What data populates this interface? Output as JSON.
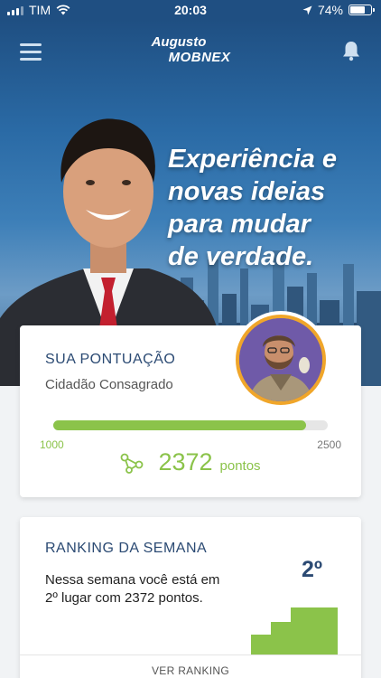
{
  "status_bar": {
    "carrier": "TIM",
    "time": "20:03",
    "battery_percent": "74%",
    "battery_level": 0.74
  },
  "header": {
    "logo_line1": "Augusto",
    "logo_line2": "MOBNEX",
    "menu_icon": "hamburger-menu-icon",
    "notification_icon": "bell-icon"
  },
  "hero": {
    "headline_lines": [
      "Experiência e",
      "novas ideias",
      "para mudar",
      "de verdade."
    ]
  },
  "score": {
    "title": "SUA PONTUAÇÃO",
    "level": "Cidadão Consagrado",
    "range_min": "1000",
    "range_max": "2500",
    "progress_fraction": 0.92,
    "points_value": "2372",
    "points_unit": "pontos"
  },
  "ranking": {
    "title": "RANKING DA SEMANA",
    "description": "Nessa semana você está em 2º lugar com 2372 pontos.",
    "position": "2º",
    "cta": "VER RANKING"
  },
  "colors": {
    "brand_blue": "#2b4a73",
    "accent_green": "#8bc34a",
    "avatar_ring": "#f0a62a"
  }
}
